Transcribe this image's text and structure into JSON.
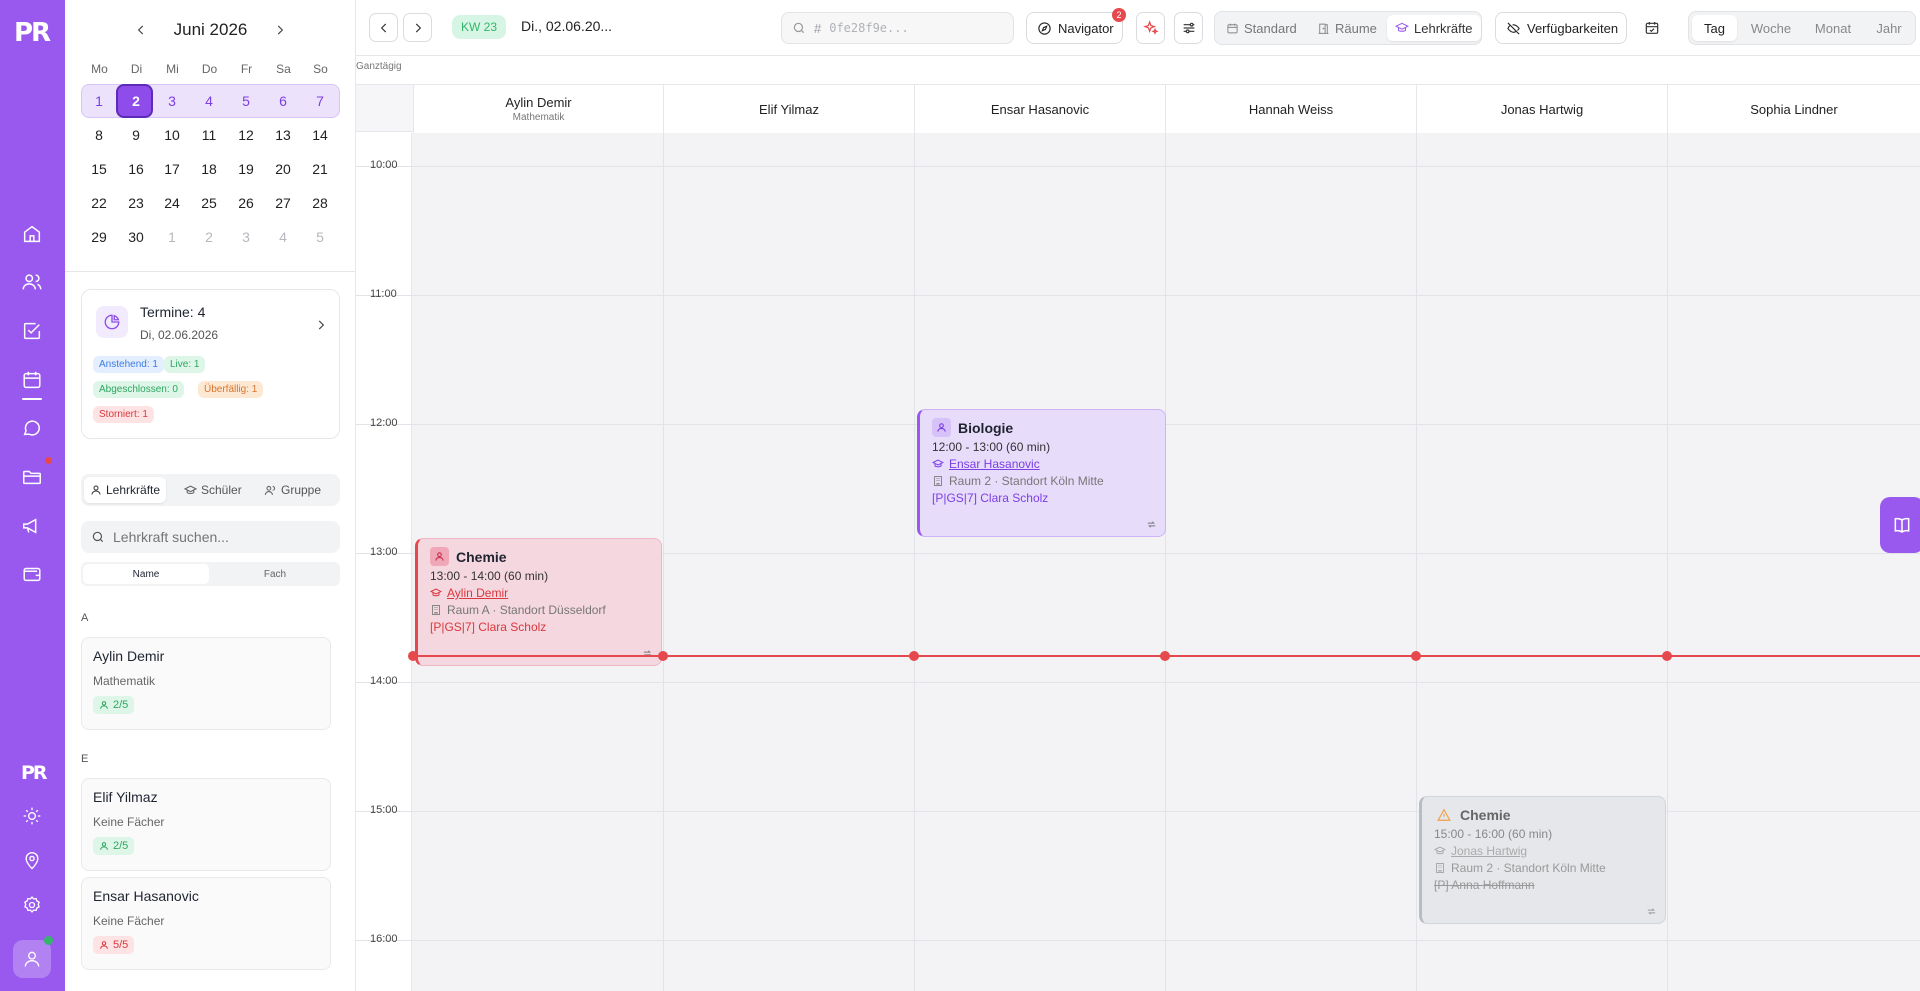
{
  "colors": {
    "brand": "#9a59ee",
    "danger": "#e5484d",
    "success": "#35b56b",
    "warning": "#f0a04b"
  },
  "rail": {
    "logo": "PR",
    "logo_small": "PR",
    "icons": [
      "home-icon",
      "users-icon",
      "check-square-icon",
      "calendar-icon",
      "chat-icon",
      "folder-icon",
      "megaphone-icon",
      "wallet-icon",
      "sun-icon",
      "location-pin-icon",
      "settings-gear-icon",
      "user-icon"
    ]
  },
  "mini_calendar": {
    "month_label": "Juni 2026",
    "weekdays": [
      "Mo",
      "Di",
      "Mi",
      "Do",
      "Fr",
      "Sa",
      "So"
    ],
    "weeks": [
      [
        "1",
        "2",
        "3",
        "4",
        "5",
        "6",
        "7"
      ],
      [
        "8",
        "9",
        "10",
        "11",
        "12",
        "13",
        "14"
      ],
      [
        "15",
        "16",
        "17",
        "18",
        "19",
        "20",
        "21"
      ],
      [
        "22",
        "23",
        "24",
        "25",
        "26",
        "27",
        "28"
      ],
      [
        "29",
        "30",
        "1",
        "2",
        "3",
        "4",
        "5"
      ]
    ],
    "selected": "2"
  },
  "summary": {
    "title": "Termine: 4",
    "date": "Di, 02.06.2026",
    "badges": {
      "pending": "Anstehend: 1",
      "live": "Live: 1",
      "done": "Abgeschlossen: 0",
      "overdue": "Überfällig: 1",
      "cancelled": "Storniert: 1"
    }
  },
  "filter_tabs": [
    "Lehrkräfte",
    "Schüler",
    "Gruppe"
  ],
  "teacher_search": {
    "placeholder": "Lehrkraft suchen..."
  },
  "sort_tabs": [
    "Name",
    "Fach"
  ],
  "teacher_list": {
    "letter_a": "A",
    "letter_e": "E",
    "items": [
      {
        "name": "Aylin Demir",
        "subject": "Mathematik",
        "count": "2/5"
      },
      {
        "name": "Elif Yilmaz",
        "subject": "Keine Fächer",
        "count": "2/5"
      },
      {
        "name": "Ensar Hasanovic",
        "subject": "Keine Fächer",
        "count": "5/5"
      }
    ]
  },
  "topbar": {
    "week_badge": "KW 23",
    "date": "Di., 02.06.20...",
    "search_hash": "#",
    "search_placeholder": "0fe28f9e...",
    "navigator_label": "Navigator",
    "navigator_count": "2",
    "views": [
      "Standard",
      "Räume",
      "Lehrkräfte"
    ],
    "active_view": "Lehrkräfte",
    "availability_label": "Verfügbarkeiten",
    "ranges": [
      "Tag",
      "Woche",
      "Monat",
      "Jahr"
    ],
    "active_range": "Tag"
  },
  "schedule": {
    "allday_label": "Ganztägig",
    "columns": [
      {
        "name": "Aylin Demir",
        "sub": "Mathematik"
      },
      {
        "name": "Elif Yilmaz",
        "sub": ""
      },
      {
        "name": "Ensar Hasanovic",
        "sub": ""
      },
      {
        "name": "Hannah Weiss",
        "sub": ""
      },
      {
        "name": "Jonas Hartwig",
        "sub": ""
      },
      {
        "name": "Sophia Lindner",
        "sub": ""
      }
    ],
    "hours": [
      "10:00",
      "11:00",
      "12:00",
      "13:00",
      "14:00",
      "15:00",
      "16:00"
    ],
    "events": [
      {
        "title": "Biologie",
        "time": "12:00 - 13:00 (60 min)",
        "teacher": "Ensar Hasanovic",
        "room": "Raum 2 · Standort Köln Mitte",
        "student": "[P|GS|7] Clara Scholz",
        "status": "live"
      },
      {
        "title": "Chemie",
        "time": "13:00 - 14:00 (60 min)",
        "teacher": "Aylin Demir",
        "room": "Raum A · Standort Düsseldorf",
        "student": "[P|GS|7] Clara Scholz",
        "status": "overdue"
      },
      {
        "title": "Chemie",
        "time": "15:00 - 16:00 (60 min)",
        "teacher": "Jonas Hartwig",
        "room": "Raum 2 · Standort Köln Mitte",
        "student": "[P] Anna Hoffmann",
        "status": "cancelled"
      }
    ]
  }
}
